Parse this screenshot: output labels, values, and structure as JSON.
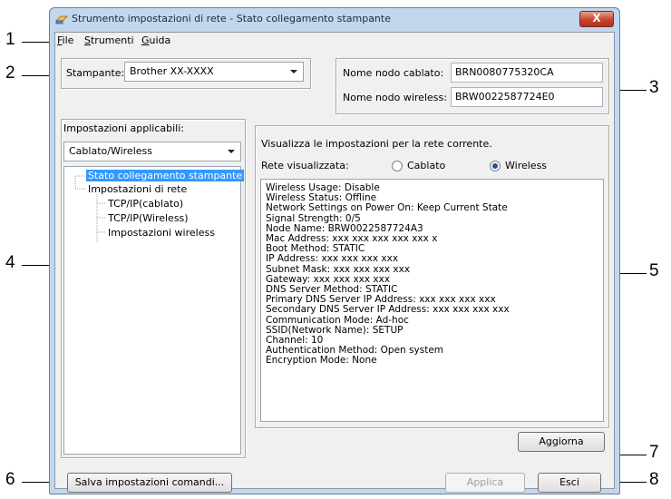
{
  "window": {
    "title": "Strumento impostazioni di rete - Stato collegamento stampante",
    "close_label": "X"
  },
  "menu": [
    "File",
    "Strumenti",
    "Guida"
  ],
  "printer": {
    "label": "Stampante:",
    "value": "Brother XX-XXXX"
  },
  "nodes": {
    "wired_label": "Nome nodo cablato:",
    "wired_value": "BRN0080775320CA",
    "wireless_label": "Nome nodo wireless:",
    "wireless_value": "BRW0022587724E0"
  },
  "left_panel": {
    "settings_label": "Impostazioni applicabili:",
    "settings_combo": "Cablato/Wireless",
    "tree": [
      "Stato collegamento stampante",
      "Impostazioni di rete",
      "TCP/IP(cablato)",
      "TCP/IP(Wireless)",
      "Impostazioni wireless"
    ]
  },
  "right_panel": {
    "heading": "Visualizza le impostazioni per la rete corrente.",
    "network_label": "Rete visualizzata:",
    "radio_wired": "Cablato",
    "radio_wireless": "Wireless",
    "selected_network": "Wireless",
    "info_lines": [
      "Wireless Usage: Disable",
      "Wireless Status: Offline",
      "Network Settings on Power On: Keep Current State",
      "Signal Strength: 0/5",
      "Node Name: BRW0022587724A3",
      "Mac Address: xxx xxx xxx xxx xxx x",
      "Boot Method: STATIC",
      "IP Address: xxx xxx xxx xxx",
      "Subnet Mask: xxx xxx xxx xxx",
      "Gateway: xxx xxx xxx xxx",
      "DNS Server Method: STATIC",
      "Primary DNS Server IP Address: xxx xxx xxx xxx",
      "Secondary DNS Server IP Address: xxx xxx xxx xxx",
      "Communication Mode: Ad-hoc",
      "SSID(Network Name): SETUP",
      "Channel: 10",
      "Authentication Method: Open system",
      "Encryption Mode: None"
    ],
    "refresh_button": "Aggiorna"
  },
  "buttons": {
    "save_commands": "Salva impostazioni comandi...",
    "apply": "Applica",
    "exit": "Esci"
  },
  "callouts": [
    "1",
    "2",
    "3",
    "4",
    "5",
    "6",
    "7",
    "8"
  ]
}
